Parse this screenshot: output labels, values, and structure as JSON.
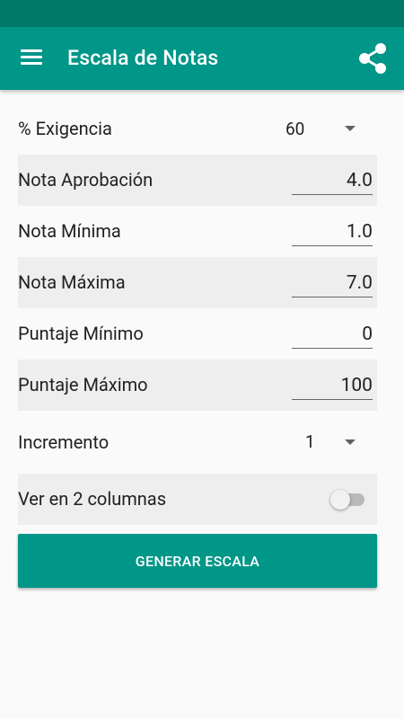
{
  "app_bar": {
    "title": "Escala de Notas",
    "menu_icon": "menu-icon",
    "share_icon": "share-icon",
    "color": "#009688",
    "status_bar_color": "#00796b"
  },
  "form": {
    "exigencia": {
      "label": "% Exigencia",
      "value": "60"
    },
    "nota_aprobacion": {
      "label": "Nota Aprobación",
      "value": "4.0"
    },
    "nota_minima": {
      "label": "Nota Mínima",
      "value": "1.0"
    },
    "nota_maxima": {
      "label": "Nota Máxima",
      "value": "7.0"
    },
    "puntaje_minimo": {
      "label": "Puntaje Mínimo",
      "value": "0"
    },
    "puntaje_maximo": {
      "label": "Puntaje Máximo",
      "value": "100"
    },
    "incremento": {
      "label": "Incremento",
      "value": "1"
    },
    "dos_columnas": {
      "label": "Ver en 2 columnas",
      "checked": false
    }
  },
  "actions": {
    "generate_label": "GENERAR ESCALA"
  }
}
